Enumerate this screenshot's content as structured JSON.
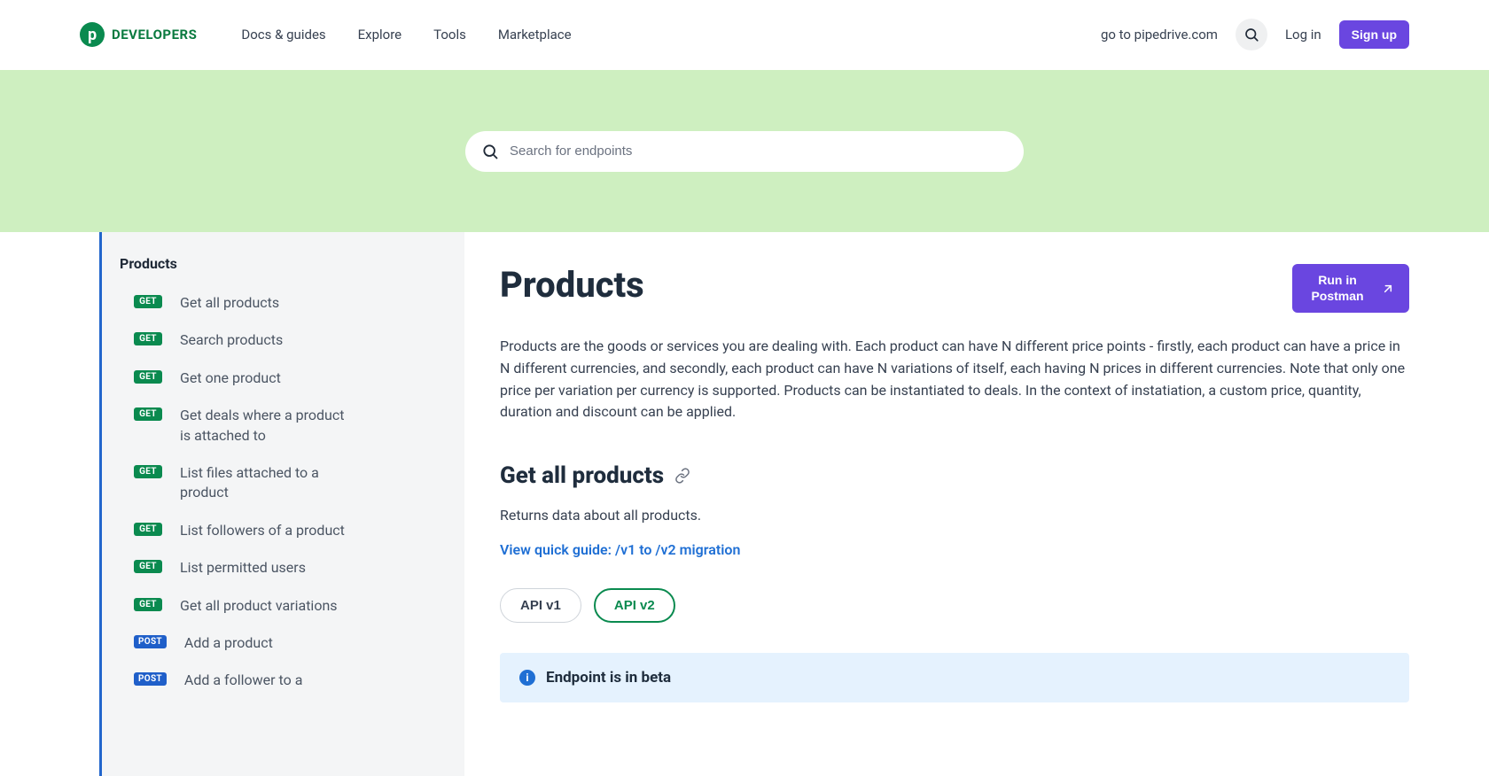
{
  "header": {
    "logo_text": "DEVELOPERS",
    "nav": [
      "Docs & guides",
      "Explore",
      "Tools",
      "Marketplace"
    ],
    "goto_link": "go to pipedrive.com",
    "login": "Log in",
    "signup": "Sign up"
  },
  "hero": {
    "search_placeholder": "Search for endpoints"
  },
  "sidebar": {
    "title": "Products",
    "items": [
      {
        "method": "GET",
        "label": "Get all products"
      },
      {
        "method": "GET",
        "label": "Search products"
      },
      {
        "method": "GET",
        "label": "Get one product"
      },
      {
        "method": "GET",
        "label": "Get deals where a product is attached to"
      },
      {
        "method": "GET",
        "label": "List files attached to a product"
      },
      {
        "method": "GET",
        "label": "List followers of a product"
      },
      {
        "method": "GET",
        "label": "List permitted users"
      },
      {
        "method": "GET",
        "label": "Get all product variations"
      },
      {
        "method": "POST",
        "label": "Add a product"
      },
      {
        "method": "POST",
        "label": "Add a follower to a"
      }
    ]
  },
  "content": {
    "title": "Products",
    "postman_label": "Run in Postman",
    "description": "Products are the goods or services you are dealing with. Each product can have N different price points - firstly, each product can have a price in N different currencies, and secondly, each product can have N variations of itself, each having N prices in different currencies. Note that only one price per variation per currency is supported. Products can be instantiated to deals. In the context of instatiation, a custom price, quantity, duration and discount can be applied.",
    "section_title": "Get all products",
    "section_desc": "Returns data about all products.",
    "guide_link": "View quick guide: /v1 to /v2 migration",
    "tabs": [
      "API v1",
      "API v2"
    ],
    "active_tab": 1,
    "beta_text": "Endpoint is in beta"
  }
}
